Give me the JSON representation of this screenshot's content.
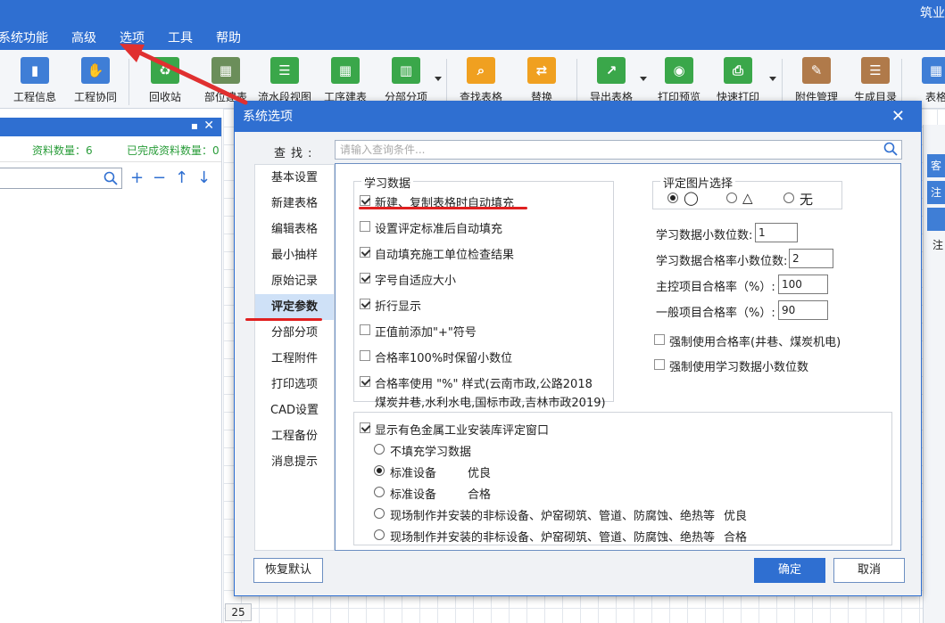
{
  "app": {
    "title": "筑业"
  },
  "menu": [
    "系统功能",
    "高级",
    "选项",
    "工具",
    "帮助"
  ],
  "ribbon": [
    {
      "label": "工程信息",
      "icon": "building-icon",
      "color": "#3f7ed6"
    },
    {
      "label": "工程协同",
      "icon": "handshake-icon",
      "color": "#3f7ed6"
    },
    {
      "label": "回收站",
      "icon": "recycle-bin-icon",
      "color": "#3aa74a"
    },
    {
      "label": "部位建表",
      "icon": "table-icon",
      "color": "#6b8e5a"
    },
    {
      "label": "流水段视图",
      "icon": "list-view-icon",
      "color": "#3aa74a"
    },
    {
      "label": "工序建表",
      "icon": "grid-icon",
      "color": "#3aa74a"
    },
    {
      "label": "分部分项",
      "icon": "chart-icon",
      "color": "#3aa74a"
    },
    {
      "label": "查找表格",
      "icon": "search-icon",
      "color": "#f0a020"
    },
    {
      "label": "替换",
      "icon": "replace-icon",
      "color": "#f0a020"
    },
    {
      "label": "导出表格",
      "icon": "export-icon",
      "color": "#3aa74a"
    },
    {
      "label": "打印预览",
      "icon": "eye-icon",
      "color": "#3aa74a"
    },
    {
      "label": "快速打印",
      "icon": "printer-icon",
      "color": "#3aa74a"
    },
    {
      "label": "附件管理",
      "icon": "paperclip-icon",
      "color": "#b07a4a"
    },
    {
      "label": "生成目录",
      "icon": "catalog-icon",
      "color": "#b07a4a"
    },
    {
      "label": "表格",
      "icon": "table-icon",
      "color": "#3f7ed6"
    }
  ],
  "left_panel": {
    "stat_count_label": "资料数量：6",
    "stat_done_label": "已完成资料数量：0"
  },
  "row_number": "25",
  "right_strip": [
    "客",
    "注",
    "注"
  ],
  "dialog": {
    "title": "系统选项",
    "find_label": "查找:",
    "find_placeholder": "请输入查询条件...",
    "nav": [
      "基本设置",
      "新建表格",
      "编辑表格",
      "最小抽样",
      "原始记录",
      "评定参数",
      "分部分项",
      "工程附件",
      "打印选项",
      "CAD设置",
      "工程备份",
      "消息提示"
    ],
    "nav_active": "评定参数",
    "study_group_title": "学习数据",
    "study_options": [
      {
        "label": "新建、复制表格时自动填充",
        "checked": true
      },
      {
        "label": "设置评定标准后自动填充",
        "checked": false
      },
      {
        "label": "自动填充施工单位检查结果",
        "checked": true
      },
      {
        "label": "字号自适应大小",
        "checked": true
      },
      {
        "label": "折行显示",
        "checked": true
      },
      {
        "label": "正值前添加\"+\"符号",
        "checked": false
      },
      {
        "label": "合格率100%时保留小数位",
        "checked": false
      },
      {
        "label": "合格率使用 \"%\" 样式(云南市政,公路2018",
        "label2": "煤炭井巷,水利水电,国标市政,吉林市政2019)",
        "checked": true
      }
    ],
    "pic_group_title": "评定图片选择",
    "pic_options": [
      {
        "label": "◯",
        "selected": true
      },
      {
        "label": "△",
        "selected": false
      },
      {
        "label": "无",
        "selected": false
      }
    ],
    "fields": [
      {
        "label": "学习数据小数位数:",
        "value": "1"
      },
      {
        "label": "学习数据合格率小数位数:",
        "value": "2"
      },
      {
        "label": "主控项目合格率（%）:",
        "value": "100"
      },
      {
        "label": "一般项目合格率（%）:",
        "value": "90"
      }
    ],
    "force_options": [
      {
        "label": "强制使用合格率(井巷、煤炭机电)",
        "checked": false
      },
      {
        "label": "强制使用学习数据小数位数",
        "checked": false
      }
    ],
    "metal_checkbox": "显示有色金属工业安装库评定窗口",
    "metal_options": [
      {
        "label": "不填充学习数据",
        "grade": "",
        "selected": false
      },
      {
        "label": "标准设备",
        "grade": "优良",
        "selected": true
      },
      {
        "label": "标准设备",
        "grade": "合格",
        "selected": false
      },
      {
        "label": "现场制作并安装的非标设备、炉窑砌筑、管道、防腐蚀、绝热等",
        "grade": "优良",
        "selected": false
      },
      {
        "label": "现场制作并安装的非标设备、炉窑砌筑、管道、防腐蚀、绝热等",
        "grade": "合格",
        "selected": false
      }
    ],
    "restore_button": "恢复默认",
    "ok_button": "确定",
    "cancel_button": "取消"
  }
}
